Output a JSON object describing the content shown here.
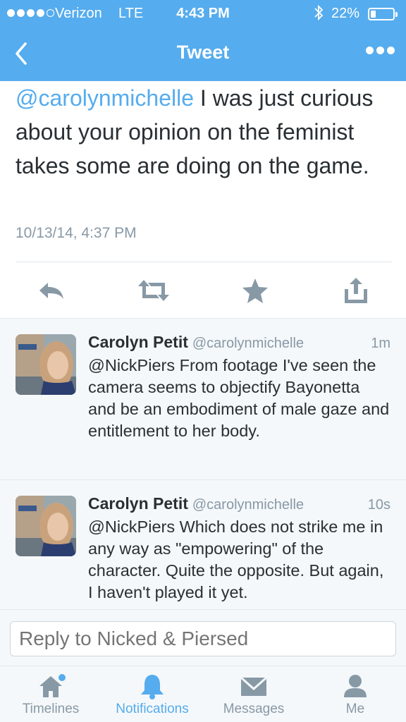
{
  "status_bar": {
    "carrier": "Verizon",
    "network": "LTE",
    "time": "4:43 PM",
    "battery_percent": "22%",
    "battery_level": 0.22,
    "signal_bars": 4,
    "signal_total": 5
  },
  "nav": {
    "title": "Tweet",
    "back_icon": "chevron-left-icon",
    "more_icon": "ellipsis-icon"
  },
  "tweet": {
    "mention": "@carolynmichelle",
    "text": " I was just curious about your opinion on the feminist takes some are doing on the game.",
    "timestamp": "10/13/14, 4:37 PM"
  },
  "actions": [
    {
      "icon": "reply-icon"
    },
    {
      "icon": "retweet-icon"
    },
    {
      "icon": "favorite-star-icon"
    },
    {
      "icon": "share-icon"
    }
  ],
  "replies": [
    {
      "name": "Carolyn Petit",
      "handle": "@carolynmichelle",
      "time": "1m",
      "text": "@NickPiers From footage I've seen the camera seems to objectify Bayonetta and be an embodiment of male gaze and entitlement to her body."
    },
    {
      "name": "Carolyn Petit",
      "handle": "@carolynmichelle",
      "time": "10s",
      "text": "@NickPiers Which does not strike me in any way as \"empowering\" of the character. Quite the opposite. But again, I haven't played it yet."
    }
  ],
  "composer": {
    "placeholder": "Reply to Nicked & Piersed"
  },
  "tabs": [
    {
      "label": "Timelines",
      "icon": "home-icon",
      "active": false,
      "badge": true
    },
    {
      "label": "Notifications",
      "icon": "bell-icon",
      "active": true
    },
    {
      "label": "Messages",
      "icon": "envelope-icon",
      "active": false
    },
    {
      "label": "Me",
      "icon": "person-icon",
      "active": false
    }
  ],
  "colors": {
    "brand_blue": "#55acee",
    "text": "#292f33",
    "muted": "#8899a6",
    "background_alt": "#f5f8fa"
  }
}
